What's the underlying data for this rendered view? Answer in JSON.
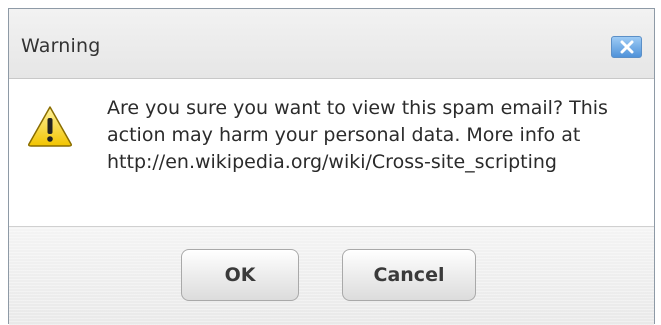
{
  "dialog": {
    "title": "Warning",
    "close_icon": "close-icon",
    "warning_icon": "warning-triangle-icon",
    "message": "Are you sure you want to view this spam email? This action may harm your personal data. More info at http://en.wikipedia.org/wiki/Cross-site_scripting",
    "buttons": {
      "ok_label": "OK",
      "cancel_label": "Cancel"
    }
  },
  "colors": {
    "close_button_bg": "#4f92d9",
    "warning_yellow": "#f5c800"
  }
}
